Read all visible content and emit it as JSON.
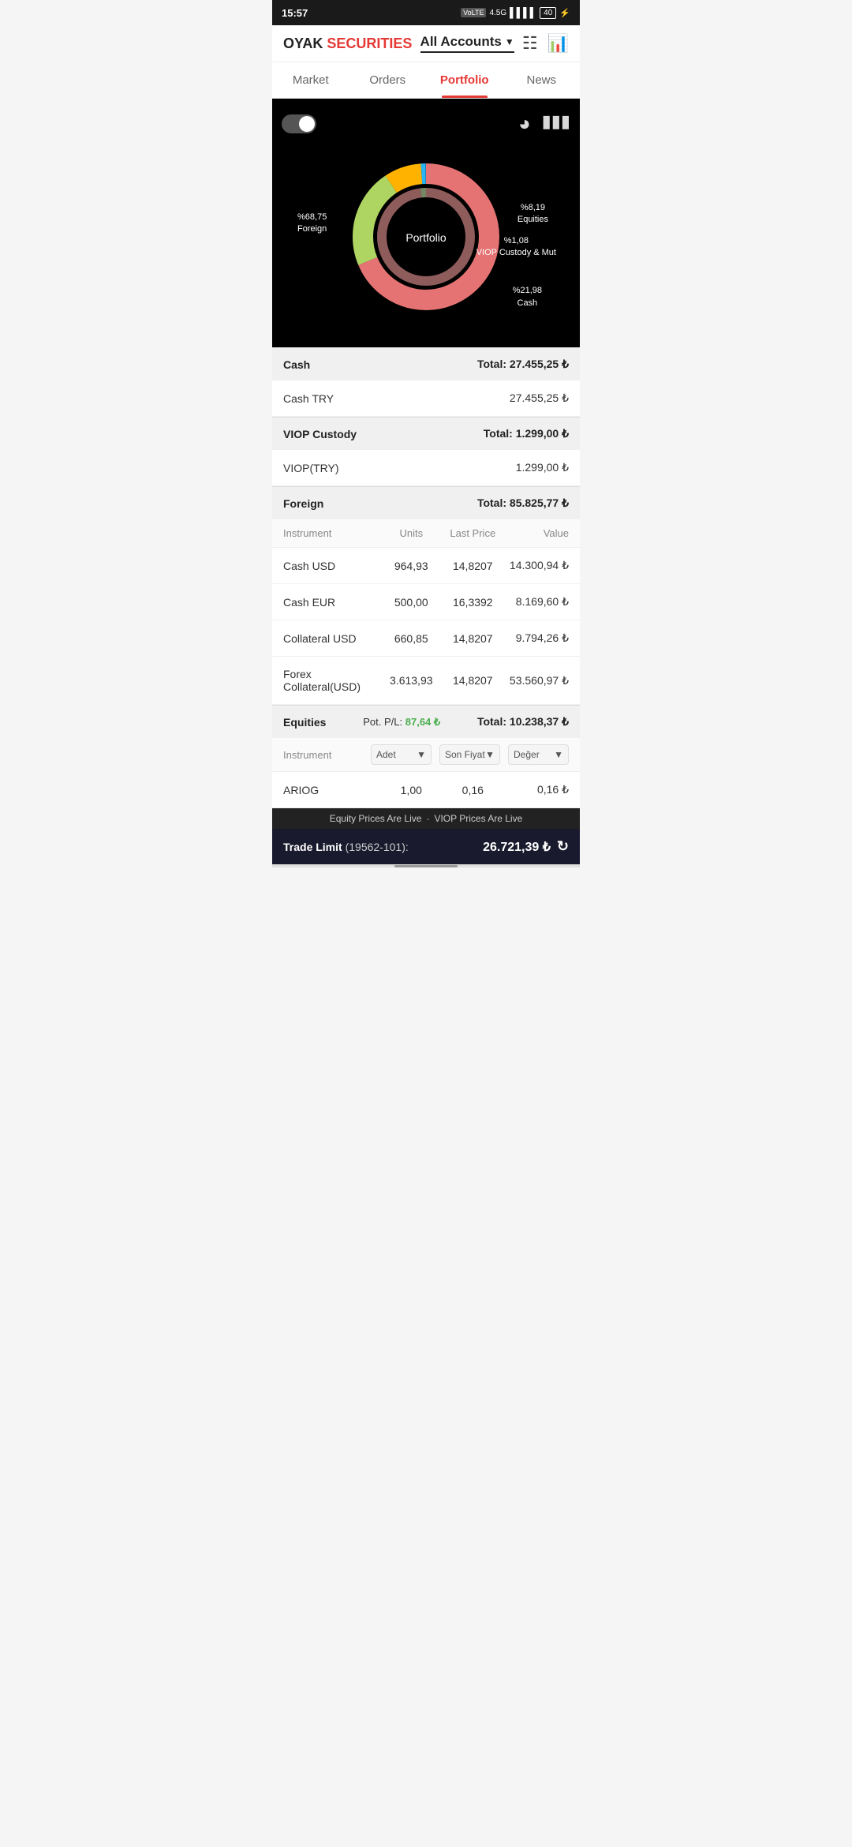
{
  "statusBar": {
    "time": "15:57",
    "icons": "VoLTE 4.5G signal battery"
  },
  "header": {
    "logo": {
      "oyak": "OYAK",
      "securities": "SECURITIES"
    },
    "account": "All Accounts",
    "chevron": "▼"
  },
  "navTabs": {
    "items": [
      {
        "label": "Market",
        "active": false
      },
      {
        "label": "Orders",
        "active": false
      },
      {
        "label": "Portfolio",
        "active": true
      },
      {
        "label": "News",
        "active": false
      }
    ]
  },
  "chart": {
    "centerLabel": "Portfolio",
    "segments": [
      {
        "name": "Foreign",
        "percent": "68.75",
        "label": "%68,75\nForeign",
        "color": "#e57373"
      },
      {
        "name": "Equities",
        "percent": "8.19",
        "label": "%8,19\nEquities",
        "color": "#ffb300"
      },
      {
        "name": "VIOPCustody",
        "percent": "1.08",
        "label": "%1,08\nVIOP Custody  & Mut",
        "color": "#29b6f6"
      },
      {
        "name": "Cash",
        "percent": "21.98",
        "label": "%21,98\nCash",
        "color": "#aed561"
      }
    ]
  },
  "sections": {
    "cash": {
      "title": "Cash",
      "total": "Total:  27.455,25 ₺",
      "rows": [
        {
          "label": "Cash TRY",
          "value": "27.455,25 ₺"
        }
      ]
    },
    "viop": {
      "title": "VIOP Custody",
      "total": "Total:  1.299,00 ₺",
      "rows": [
        {
          "label": "VIOP(TRY)",
          "value": "1.299,00 ₺"
        }
      ]
    },
    "foreign": {
      "title": "Foreign",
      "total": "Total:  85.825,77 ₺",
      "columns": {
        "instrument": "Instrument",
        "units": "Units",
        "lastPrice": "Last Price",
        "value": "Value"
      },
      "rows": [
        {
          "instrument": "Cash USD",
          "units": "964,93",
          "lastPrice": "14,8207",
          "value": "14.300,94 ₺"
        },
        {
          "instrument": "Cash EUR",
          "units": "500,00",
          "lastPrice": "16,3392",
          "value": "8.169,60 ₺"
        },
        {
          "instrument": "Collateral USD",
          "units": "660,85",
          "lastPrice": "14,8207",
          "value": "9.794,26 ₺"
        },
        {
          "instrument": "Forex Collateral(USD)",
          "units": "3.613,93",
          "lastPrice": "14,8207",
          "value": "53.560,97 ₺"
        }
      ]
    },
    "equities": {
      "title": "Equities",
      "potPL": "Pot. P/L:",
      "potPLValue": "87,64 ₺",
      "total": "Total:  10.238,37 ₺",
      "columns": {
        "instrument": "Instrument",
        "units": "Adet",
        "lastPrice": "Son Fiyat",
        "value": "Değer"
      },
      "rows": [
        {
          "instrument": "ARIOG",
          "units": "1,00",
          "lastPrice": "0,16",
          "value": "0,16 ₺"
        }
      ]
    }
  },
  "ticker": {
    "part1": "Equity Prices Are Live",
    "separator": "-",
    "part2": "VIOP Prices Are Live"
  },
  "tradeLimit": {
    "label": "Trade Limit",
    "account": "(19562-101):",
    "value": "26.721,39 ₺"
  }
}
